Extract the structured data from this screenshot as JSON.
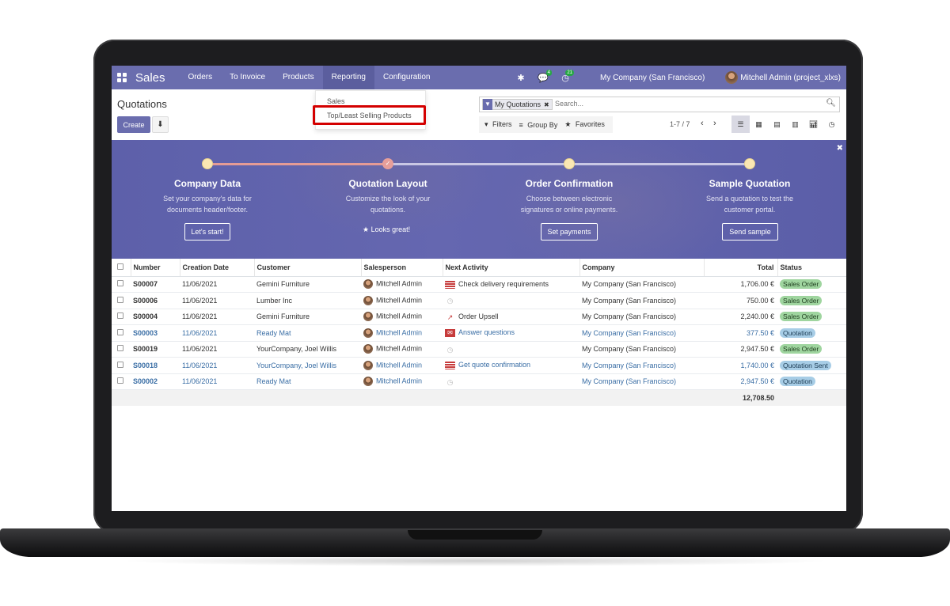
{
  "navbar": {
    "brand": "Sales",
    "menu": [
      "Orders",
      "To Invoice",
      "Products",
      "Reporting",
      "Configuration"
    ],
    "bug_icon": "bug-icon",
    "messages_badge": "4",
    "activities_badge": "21",
    "company": "My Company (San Francisco)",
    "user": "Mitchell Admin (project_xlxs)"
  },
  "control_panel": {
    "title": "Quotations",
    "create_label": "Create",
    "search": {
      "facet": "My Quotations",
      "placeholder": "Search..."
    },
    "filters_label": "Filters",
    "groupby_label": "Group By",
    "favorites_label": "Favorites",
    "pager": "1-7 / 7"
  },
  "reporting_dropdown": {
    "items": [
      "Sales",
      "Top/Least Selling Products"
    ]
  },
  "onboarding": {
    "steps": [
      {
        "title": "Company Data",
        "desc_line1": "Set your company's data for",
        "desc_line2": "documents header/footer.",
        "button": "Let's start!"
      },
      {
        "title": "Quotation Layout",
        "desc_line1": "Customize the look of your",
        "desc_line2": "quotations.",
        "done_text": "Looks great!"
      },
      {
        "title": "Order Confirmation",
        "desc_line1": "Choose between electronic",
        "desc_line2": "signatures or online payments.",
        "button": "Set payments"
      },
      {
        "title": "Sample Quotation",
        "desc_line1": "Send a quotation to test the",
        "desc_line2": "customer portal.",
        "button": "Send sample"
      }
    ]
  },
  "table": {
    "headers": [
      "Number",
      "Creation Date",
      "Customer",
      "Salesperson",
      "Next Activity",
      "Company",
      "Total",
      "Status"
    ],
    "rows": [
      {
        "number": "S00007",
        "date": "11/06/2021",
        "customer": "Gemini Furniture",
        "salesperson": "Mitchell Admin",
        "activity": "Check delivery requirements",
        "company": "My Company (San Francisco)",
        "total": "1,706.00 €",
        "status": "Sales Order"
      },
      {
        "number": "S00006",
        "date": "11/06/2021",
        "customer": "Lumber Inc",
        "salesperson": "Mitchell Admin",
        "activity": "",
        "company": "My Company (San Francisco)",
        "total": "750.00 €",
        "status": "Sales Order"
      },
      {
        "number": "S00004",
        "date": "11/06/2021",
        "customer": "Gemini Furniture",
        "salesperson": "Mitchell Admin",
        "activity": "Order Upsell",
        "company": "My Company (San Francisco)",
        "total": "2,240.00 €",
        "status": "Sales Order"
      },
      {
        "number": "S00003",
        "date": "11/06/2021",
        "customer": "Ready Mat",
        "salesperson": "Mitchell Admin",
        "activity": "Answer questions",
        "company": "My Company (San Francisco)",
        "total": "377.50 €",
        "status": "Quotation"
      },
      {
        "number": "S00019",
        "date": "11/06/2021",
        "customer": "YourCompany, Joel Willis",
        "salesperson": "Mitchell Admin",
        "activity": "",
        "company": "My Company (San Francisco)",
        "total": "2,947.50 €",
        "status": "Sales Order"
      },
      {
        "number": "S00018",
        "date": "11/06/2021",
        "customer": "YourCompany, Joel Willis",
        "salesperson": "Mitchell Admin",
        "activity": "Get quote confirmation",
        "company": "My Company (San Francisco)",
        "total": "1,740.00 €",
        "status": "Quotation Sent"
      },
      {
        "number": "S00002",
        "date": "11/06/2021",
        "customer": "Ready Mat",
        "salesperson": "Mitchell Admin",
        "activity": "",
        "company": "My Company (San Francisco)",
        "total": "2,947.50 €",
        "status": "Quotation"
      }
    ],
    "grand_total": "12,708.50"
  },
  "colors": {
    "brand": "#6a6dae",
    "highlight_box": "#d40000",
    "status_green": "#9fd59f",
    "status_blue": "#a7cde6"
  }
}
